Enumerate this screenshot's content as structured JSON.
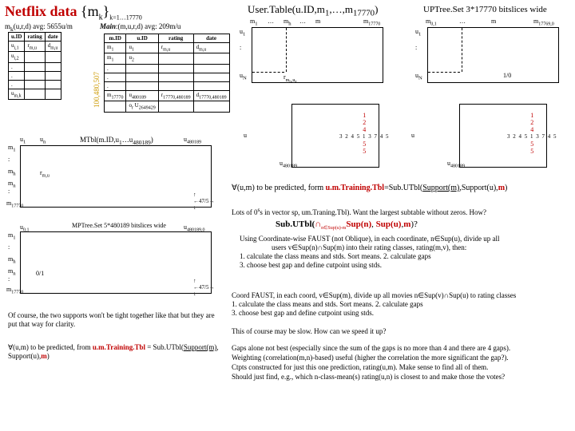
{
  "title_a": "Netflix data",
  "title_b": " {m",
  "title_c": "k",
  "title_d": "}",
  "title_e": "k=1…17770",
  "user_table": "User.Table(u.ID,m",
  "user_table2": "1",
  "user_table3": ",…,m",
  "user_table4": "17770",
  "user_table5": ")",
  "uptree": "UPTree.Set 3*17770 bitslices wide",
  "mk_caption": "(u,r,d)   avg: 5655u/m",
  "mk_prefix": "m",
  "mk_k": "k",
  "mk_h1": "u.ID",
  "mk_h2": "rating",
  "mk_h3": "date",
  "mk_r1c1": "u",
  "mk_r1c2": "r",
  "mk_r1c3": "d",
  "main_label": "Main",
  "main_caption": ":(m,u,r,d)   avg: 209m/u",
  "main_h1": "m.ID",
  "main_h2": "u.ID",
  "main_h3": "rating",
  "main_h4": "date",
  "main_m1": "m",
  "main_u1": "u",
  "main_r": "r",
  "main_d": "d",
  "main_last": "m",
  "main_last2": "17770",
  "main_last_u": "u",
  "main_last_u2": "480189",
  "main_last_r": "r",
  "main_last_d": "d",
  "main_o": "o",
  "main_U": "U",
  "main_U2": "2649429",
  "sidebar": "100,480,507",
  "mtbl": "MTbl(m.ID,u",
  "mtbl2": "1",
  "mtbl3": "…u",
  "mtbl4": "480189",
  "mtbl5": ")",
  "mtbl_u1": "u",
  "mtbl_un": "u",
  "mtbl_uend": "u",
  "mtbl_uend2": "480189",
  "mtbl_m": "m",
  "mtbl_mh": "m",
  "mtbl_mn": "m",
  "mtbl_rmh": "r",
  "mtbl_17": "17770",
  "mtbl_475": "←47/5→",
  "mptree": "MPTree.Set   5*480189 bitslices wide",
  "mptree_u01": "u",
  "mptree_uend": "u",
  "mptree_uend2": "480189,0",
  "mptree_01": "0/1",
  "mptree_475": "←47/5→",
  "ut_m1": "m",
  "ut_mh": "m",
  "ut_mn": "m",
  "ut_m17": "m",
  "ut_m17b": "17770",
  "ut_u1": "u",
  "ut_u1b": "1",
  "ut_uN": "u",
  "ut_uNb": "N",
  "ut_rm": "r",
  "ut_rm2": "m",
  "ut_dots": ":",
  "ut_ell": "…",
  "up_m01": "m",
  "up_m01b": "0,1",
  "up_mend": "m",
  "up_mend2": "17769,0",
  "up_10": "1/0",
  "slice1": "1",
  "slice2": "2",
  "slice4": "4",
  "slice_digits": "3 2 4 5 1 3 7 4 5",
  "slice5a": "5",
  "slice5b": "5",
  "side_u": "u",
  "side_480": "480189",
  "pred_line_a": "∀(u,m) to be predicted, form  ",
  "pred_line_b": "u.m.Training.Tbl",
  "pred_line_c": "=Sub.UTbl(",
  "pred_line_d": "Support(m)",
  "pred_line_e": ",Support(u),",
  "pred_line_f": "m",
  "pred_line_g": ")",
  "lots": "Lots of 0",
  "lots2": "s in vector sp, um.Traning.Tbl).  Want the largest subtable without zeros.  How?",
  "subutbl_a": "Sub.UTbl(",
  "subutbl_b": "∩",
  "subutbl_c": "n∈Sup(u)-m",
  "subutbl_d": "Sup(n)",
  "subutbl_e": ", ",
  "subutbl_f": "Sup(u)",
  "subutbl_g": ",",
  "subutbl_h": "m",
  "subutbl_i": ")?",
  "algo1": "Using Coordinate-wise FAUST (not Oblique), in each coordinate, n∈Sup(u), divide up all",
  "algo2": "users v∈Sup(n)∩Sup(m) into their rating classes, rating(m,v), then:",
  "algo3": "1. calculate the class means and stds. Sort means.        2. calculate gaps",
  "algo4": "3. choose best gap and define cutpoint using stds.",
  "ofcourse": "Of course, the two supports won't be tight together like that but they are put that way for clarity.",
  "pred2a": "∀(u,m) to be predicted, from ",
  "pred2b": "u.m.Training.Tbl",
  "pred2c": " = Sub.UTbl(",
  "pred2d": "Support(m)",
  "pred2e": ", Support(u),",
  "pred2f": "m",
  "pred2g": ")",
  "coord1": "Coord FAUST, in each coord, v∈Sup(m), divide up all movies n∈Sup(v)∩Sup(u) to rating classes",
  "coord2": "1. calculate the class means and stds. Sort means.      2. calculate gaps",
  "coord3": "3. choose best gap and define cutpoint using stds.",
  "slow": "This of course may be slow.    How can we speed it up?",
  "gaps1": "Gaps alone not best (especially since the sum of the gaps is no more than 4 and there are 4 gaps).",
  "gaps2": "Weighting (correlation(m,n)-based) useful (higher the correlation the more significant the gap?).",
  "gaps3": "Ctpts constructed for just this one prediction, rating(u,m).  Make sense to find all of them.",
  "gaps4": "Should just find, e.g., which n-class-mean(s) rating(u,n) is closest to and make those the votes?"
}
